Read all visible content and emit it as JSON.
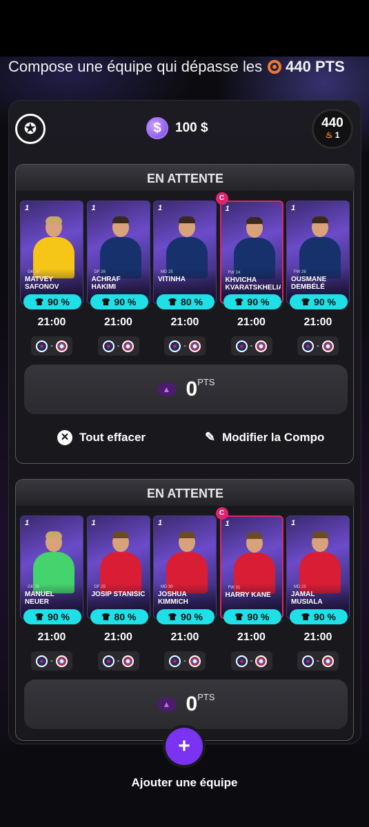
{
  "header": {
    "headline": "Compose une équipe qui dépasse les",
    "target_points": "440 PTS"
  },
  "summary": {
    "budget": "100 $",
    "coin_symbol": "$",
    "score": "440",
    "streak": "1"
  },
  "teams": [
    {
      "status": "EN ATTENTE",
      "players": [
        {
          "name": "MATVEY SAFONOV",
          "pct": "90 %",
          "time": "21:00",
          "kit": "keeper",
          "captain": false,
          "meta": "GK  26"
        },
        {
          "name": "ACHRAF HAKIMI",
          "pct": "90 %",
          "time": "21:00",
          "kit": "psg",
          "captain": false,
          "meta": "DF  26"
        },
        {
          "name": "VITINHA",
          "pct": "80 %",
          "time": "21:00",
          "kit": "psg",
          "captain": false,
          "meta": "MD  25"
        },
        {
          "name": "KHVICHA KVARATSKHELIA",
          "pct": "90 %",
          "time": "21:00",
          "kit": "psg",
          "captain": true,
          "meta": "FW  24"
        },
        {
          "name": "OUSMANE DEMBÉLÉ",
          "pct": "90 %",
          "time": "21:00",
          "kit": "psg",
          "captain": false,
          "meta": "FW  28"
        }
      ],
      "points_value": "0",
      "points_unit": "PTS",
      "actions": {
        "clear": "Tout effacer",
        "edit": "Modifier la Compo"
      }
    },
    {
      "status": "EN ATTENTE",
      "players": [
        {
          "name": "MANUEL NEUER",
          "pct": "90 %",
          "time": "21:00",
          "kit": "keeper2",
          "captain": false,
          "meta": "GK  39"
        },
        {
          "name": "JOSIP STANIŠIĆ",
          "pct": "80 %",
          "time": "21:00",
          "kit": "bayern",
          "captain": false,
          "meta": "DF  25"
        },
        {
          "name": "JOSHUA KIMMICH",
          "pct": "90 %",
          "time": "21:00",
          "kit": "bayern",
          "captain": false,
          "meta": "MD  30"
        },
        {
          "name": "HARRY KANE",
          "pct": "90 %",
          "time": "21:00",
          "kit": "bayern",
          "captain": true,
          "meta": "FW  31"
        },
        {
          "name": "JAMAL MUSIALA",
          "pct": "90 %",
          "time": "21:00",
          "kit": "bayern",
          "captain": false,
          "meta": "MD  22"
        }
      ],
      "points_value": "0",
      "points_unit": "PTS"
    }
  ],
  "captain_letter": "C",
  "match": {
    "home": "psg",
    "away": "bayern",
    "separator": "-"
  },
  "add_team": {
    "label": "Ajouter une équipe",
    "icon": "+"
  },
  "colors": {
    "accent": "#7a33f0",
    "pill": "#1ee0e6",
    "captain": "#e0236e",
    "psg_kit": "#16316b",
    "bayern_kit": "#d81d35",
    "keeper_kit": "#f5c518",
    "keeper2_kit": "#44d36c"
  }
}
